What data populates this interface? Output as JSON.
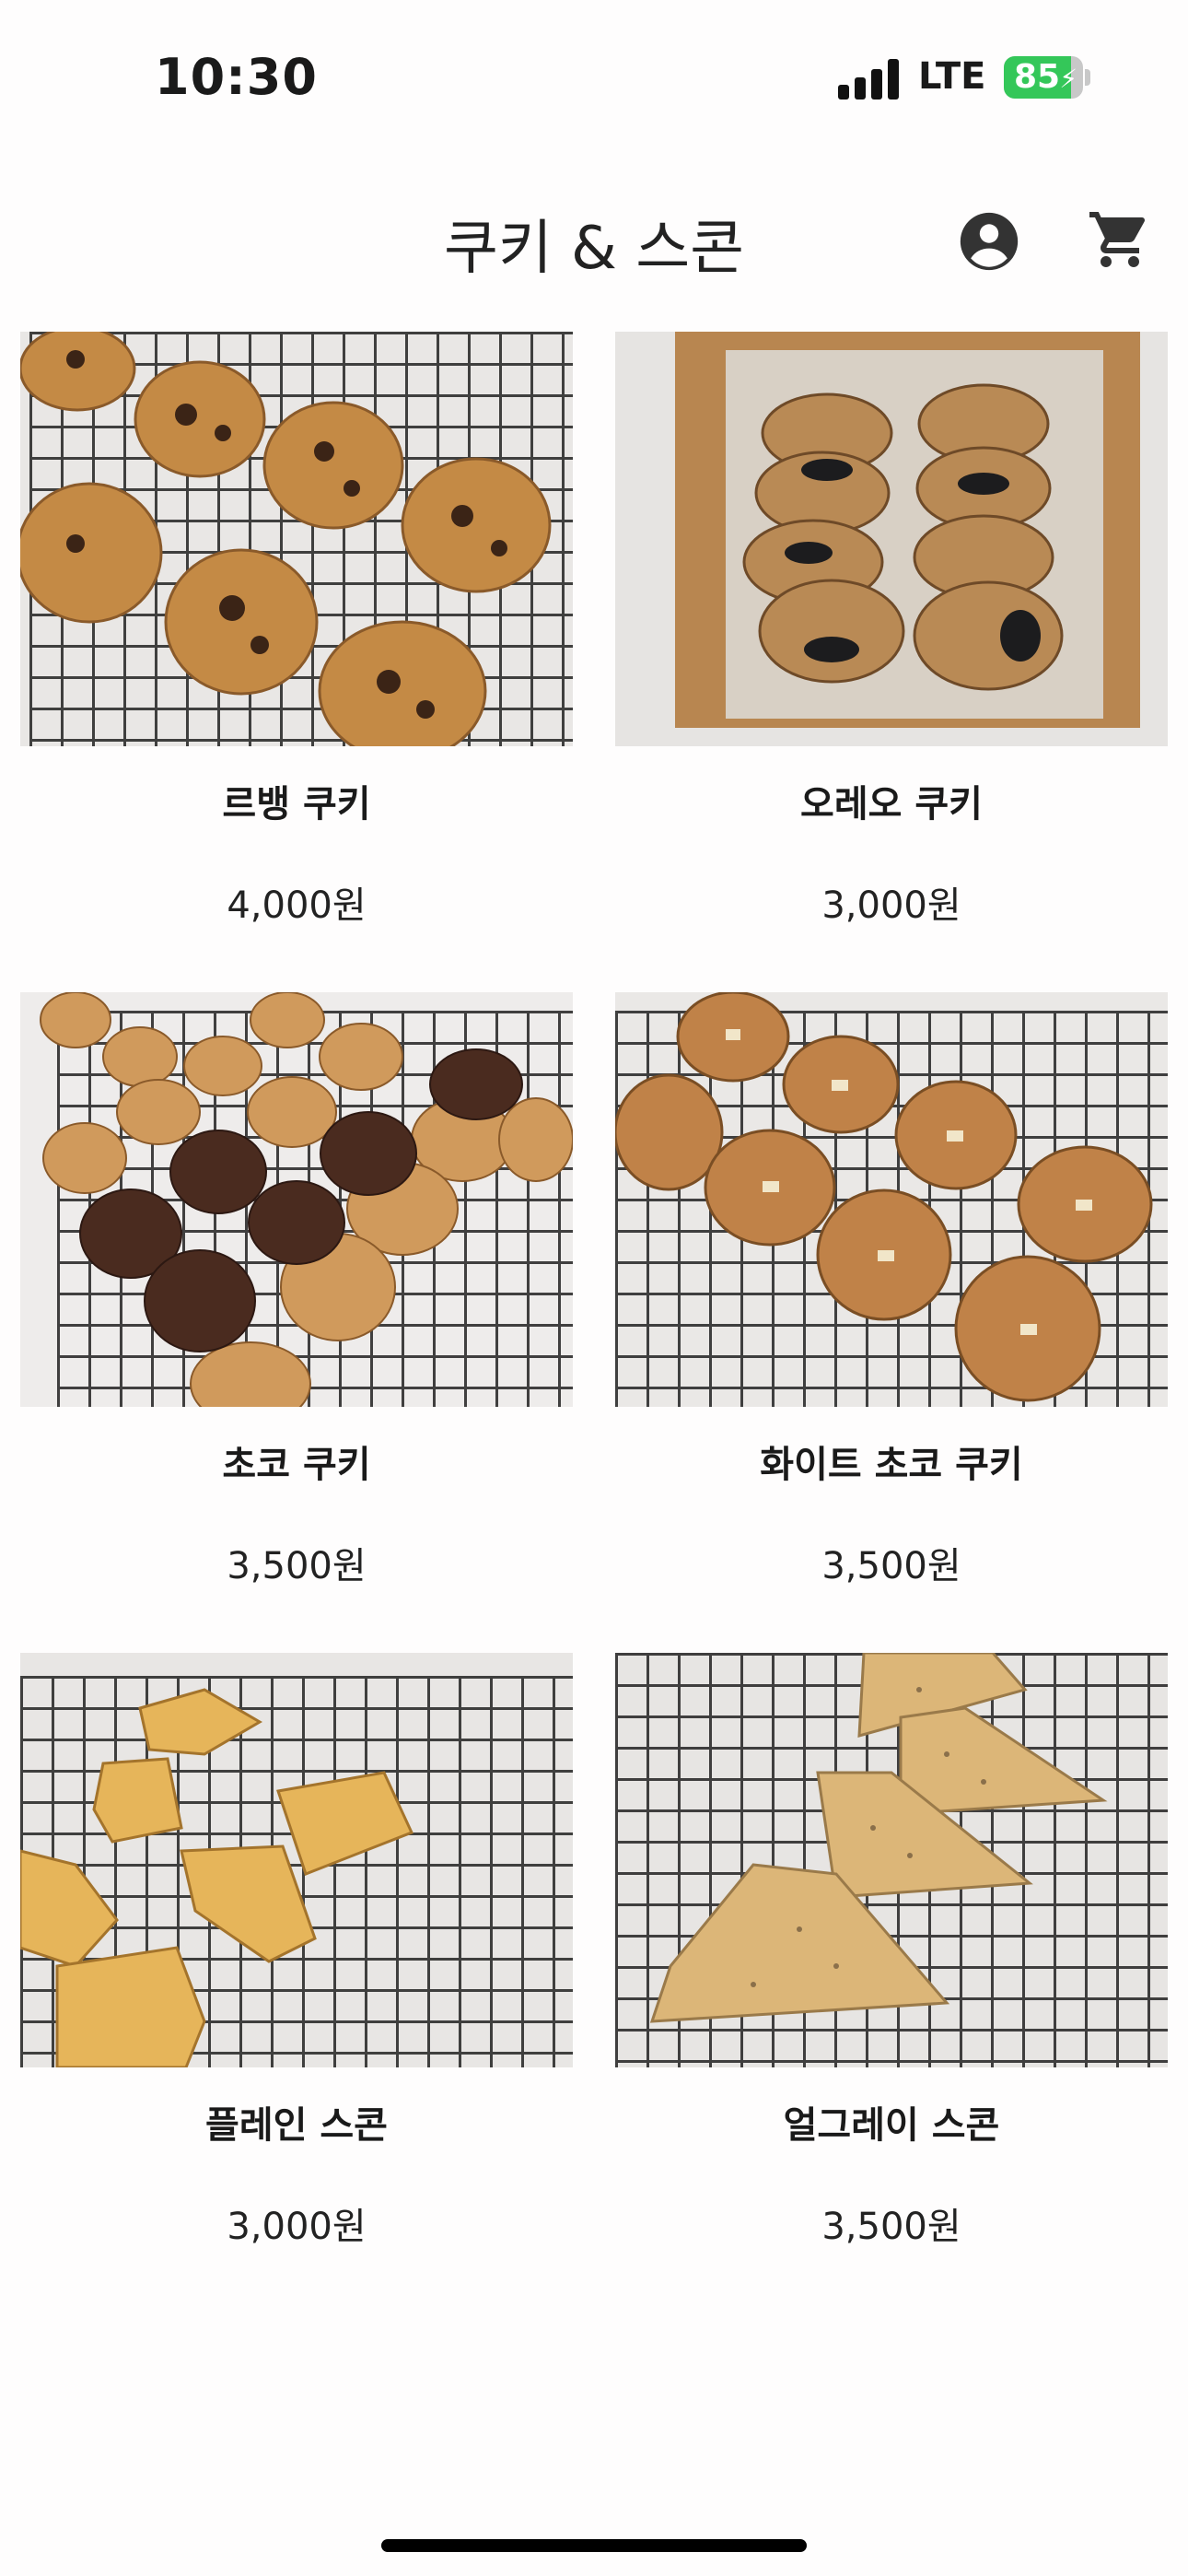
{
  "status": {
    "time": "10:30",
    "network": "LTE",
    "battery": "85",
    "battery_level": 0.85
  },
  "header": {
    "title": "쿠키 & 스콘",
    "profile_icon": "account-circle-icon",
    "cart_icon": "shopping-cart-icon"
  },
  "products": [
    {
      "name": "르뱅 쿠키",
      "price": "4,000원"
    },
    {
      "name": "오레오 쿠키",
      "price": "3,000원"
    },
    {
      "name": "초코 쿠키",
      "price": "3,500원"
    },
    {
      "name": "화이트 초코 쿠키",
      "price": "3,500원"
    },
    {
      "name": "플레인 스콘",
      "price": "3,000원"
    },
    {
      "name": "얼그레이 스콘",
      "price": "3,500원"
    }
  ]
}
